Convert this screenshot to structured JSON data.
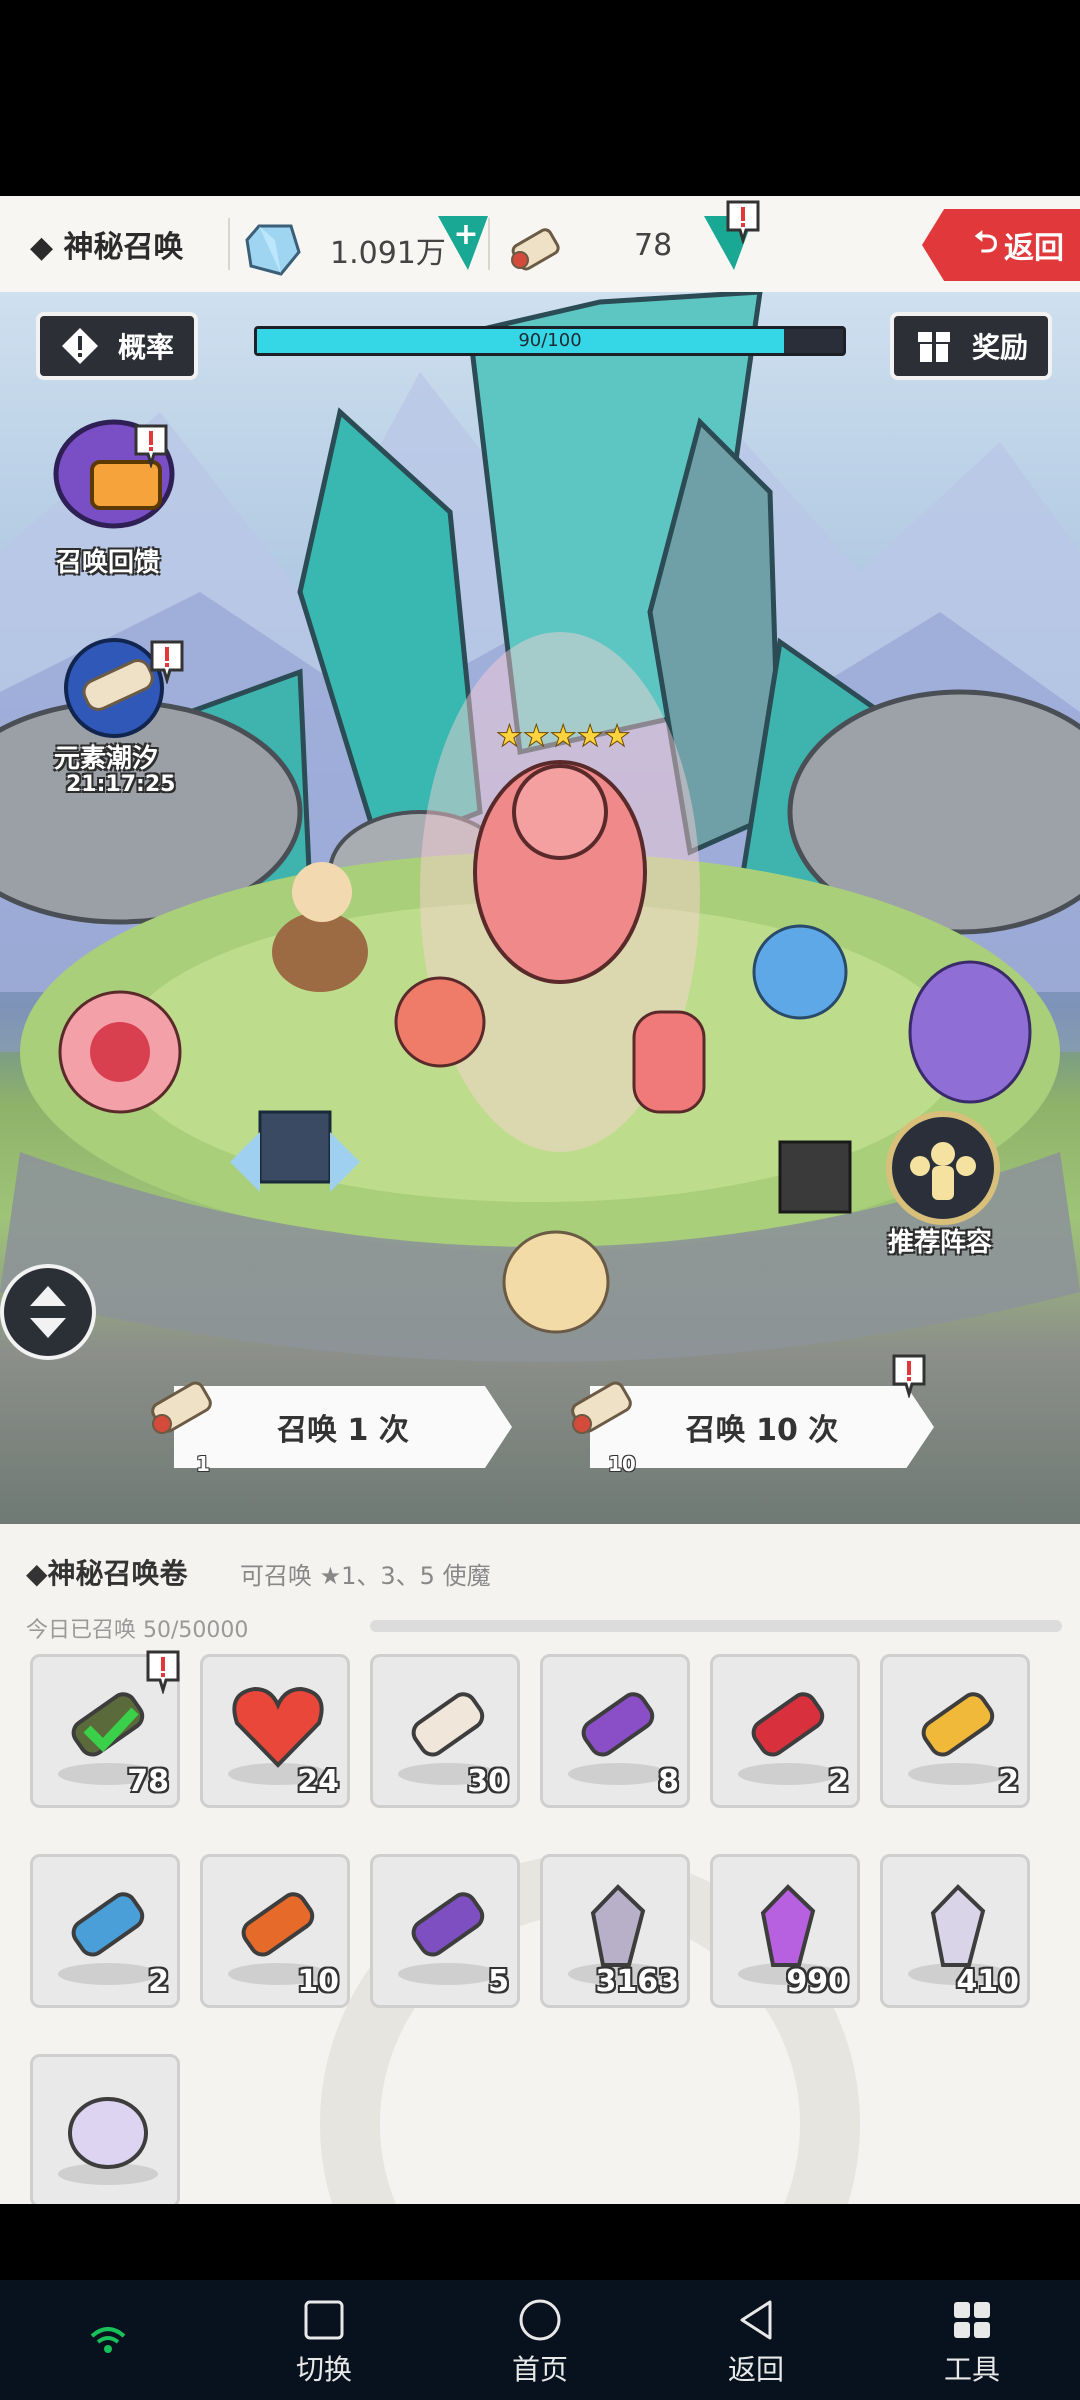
{
  "header": {
    "title": "◆ 神秘召唤",
    "gems": "1.091万",
    "scrolls": "78",
    "back_label": "返回"
  },
  "scene": {
    "rate_label": "概率",
    "reward_label": "奖励",
    "progress_text": "90/100",
    "progress_fraction": 0.9,
    "summon_feedback_label": "召唤回馈",
    "element_tide_label": "元素潮汐",
    "element_tide_timer": "21:17:25",
    "recommend_label": "推荐阵容",
    "summon_one_label": "召唤 1 次",
    "summon_one_cost": "1",
    "summon_ten_label": "召唤 10 次",
    "summon_ten_cost": "10"
  },
  "panel": {
    "title": "◆神秘召唤卷",
    "subtitle": "可召唤 ★1、3、5 使魔",
    "today": "今日已召唤 50/50000",
    "items": [
      {
        "name": "green-check-scroll",
        "count": "78",
        "color": "#5a6a3a"
      },
      {
        "name": "heart",
        "count": "24",
        "color": "#e8473a"
      },
      {
        "name": "white-scroll-bag",
        "count": "30",
        "color": "#f0e6da"
      },
      {
        "name": "purple-scroll",
        "count": "8",
        "color": "#8a4fc6"
      },
      {
        "name": "red-scroll",
        "count": "2",
        "color": "#d8313d"
      },
      {
        "name": "gold-scroll",
        "count": "2",
        "color": "#f1b93a"
      },
      {
        "name": "blue-scroll",
        "count": "2",
        "color": "#4a9fd8"
      },
      {
        "name": "orange-scroll-stack",
        "count": "10",
        "color": "#e66a2a"
      },
      {
        "name": "violet-scroll-stack",
        "count": "5",
        "color": "#7d4fc0"
      },
      {
        "name": "grey-crystal",
        "count": "3163",
        "color": "#b8b0c8"
      },
      {
        "name": "purple-crystal",
        "count": "990",
        "color": "#b760e0"
      },
      {
        "name": "orb-crystal",
        "count": "410",
        "color": "#d9d4e8"
      },
      {
        "name": "five-star-orb",
        "count": "",
        "color": "#dcd4f0"
      }
    ]
  },
  "navbar": {
    "switch_label": "切换",
    "home_label": "首页",
    "back_label": "返回",
    "tools_label": "工具"
  },
  "colors": {
    "accent_red": "#e0383b",
    "progress_cyan": "#35d7e6",
    "alert_teal": "#1bb7a6"
  }
}
